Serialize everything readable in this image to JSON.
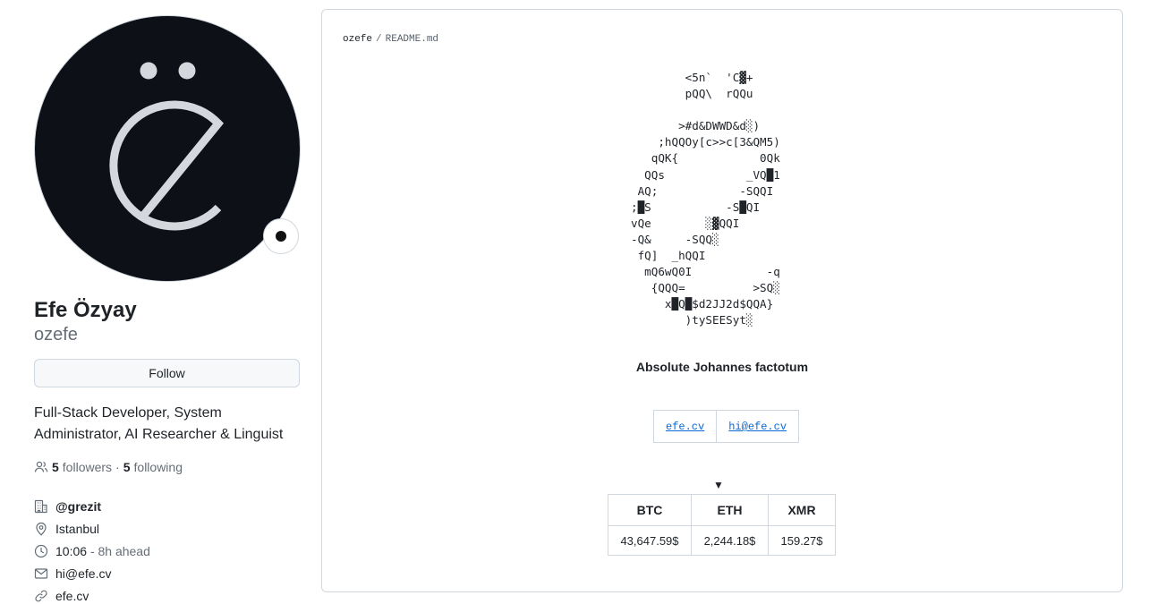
{
  "profile": {
    "name": "Efe Özyay",
    "login": "ozefe",
    "follow_label": "Follow",
    "bio": "Full-Stack Developer, System Administrator, AI Researcher & Linguist",
    "followers_count": "5",
    "followers_label": "followers",
    "separator": "·",
    "following_count": "5",
    "following_label": "following",
    "details": {
      "organization": "@grezit",
      "location": "Istanbul",
      "local_time": "10:06",
      "time_offset": "- 8h ahead",
      "email": "hi@efe.cv",
      "website": "efe.cv"
    },
    "avatar_icon": "e-diaeresis-logo",
    "status_icon": "status-dot-icon"
  },
  "readme": {
    "path_owner": "ozefe",
    "path_separator": "/",
    "path_file": "README.md",
    "ascii_art": "        <5n`  'C▓+\n        pQQ\\  rQQu\n\n       >#d&DWWD&d░)\n    ;hQQOy[c>>c[3&QM5)\n   qQK{            0Qk\n  QQs            _VQ█1\n AQ;            -SQQI\n;█S           -S█QI\nvQe        ░▓QQI\n-Q&     -SQQ░\n fQ]  _hQQI\n  mQ6wQ0I           -q\n   {QQQ=          >SQ░\n     x█Q█$d2JJ2d$QQA}\n        )tySEESyt░",
    "caption": "Absolute Johannes factotum",
    "links": [
      "efe.cv",
      "hi@efe.cv"
    ],
    "toggle_marker": "▼",
    "crypto": {
      "headers": [
        "BTC",
        "ETH",
        "XMR"
      ],
      "values": [
        "43,647.59$",
        "2,244.18$",
        "159.27$"
      ]
    }
  }
}
